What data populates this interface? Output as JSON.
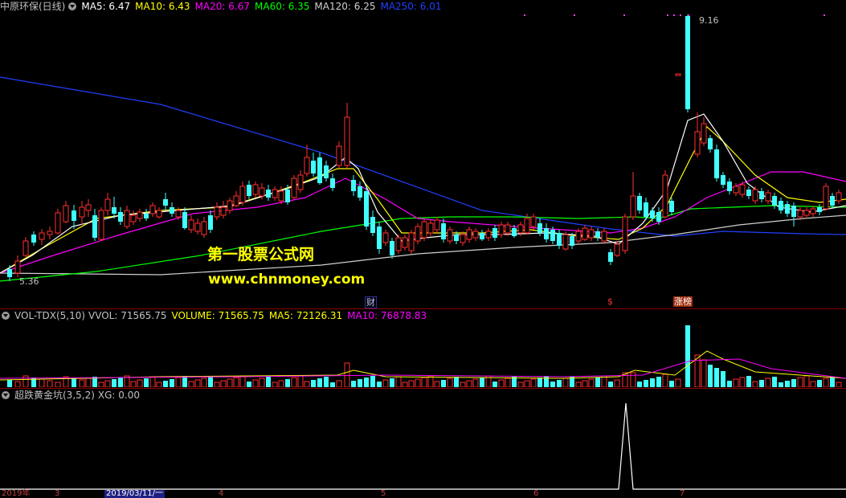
{
  "main_legend": {
    "stock": "中原环保(日线)",
    "items": [
      {
        "label": "MA5: 6.47",
        "color": "#ffffff"
      },
      {
        "label": "MA10: 6.43",
        "color": "#ffff00"
      },
      {
        "label": "MA20: 6.67",
        "color": "#ff00ff"
      },
      {
        "label": "MA60: 6.35",
        "color": "#00ff00"
      },
      {
        "label": "MA120: 6.25",
        "color": "#d0d0d0"
      },
      {
        "label": "MA250: 6.01",
        "color": "#2040ff"
      }
    ]
  },
  "price_labels": {
    "high": "9.16",
    "low": "5.36"
  },
  "watermark": {
    "line1": "第一股票公式网",
    "line2": "www.chnmoney.com"
  },
  "event_tags": [
    "财",
    "$",
    "涨榜"
  ],
  "vol_legend": {
    "name": "VOL-TDX(5,10)",
    "items": [
      {
        "label": "VVOL: 71565.75",
        "color": "#c0c0c0"
      },
      {
        "label": "VOLUME: 71565.75",
        "color": "#ffff00"
      },
      {
        "label": "MA5: 72126.31",
        "color": "#ffff00"
      },
      {
        "label": "MA10: 76878.83",
        "color": "#ff00ff"
      }
    ]
  },
  "ind_legend": {
    "name": "超跌黄金坑(3,5,2)",
    "items": [
      {
        "label": "XG: 0.00",
        "color": "#c0c0c0"
      }
    ]
  },
  "x_axis": {
    "labels": [
      "2019年",
      "3",
      "2019/03/11/一",
      "4",
      "5",
      "6",
      "7"
    ]
  },
  "colors": {
    "up": "#ff3030",
    "down": "#40ffff",
    "frame": "#8b0000"
  }
}
